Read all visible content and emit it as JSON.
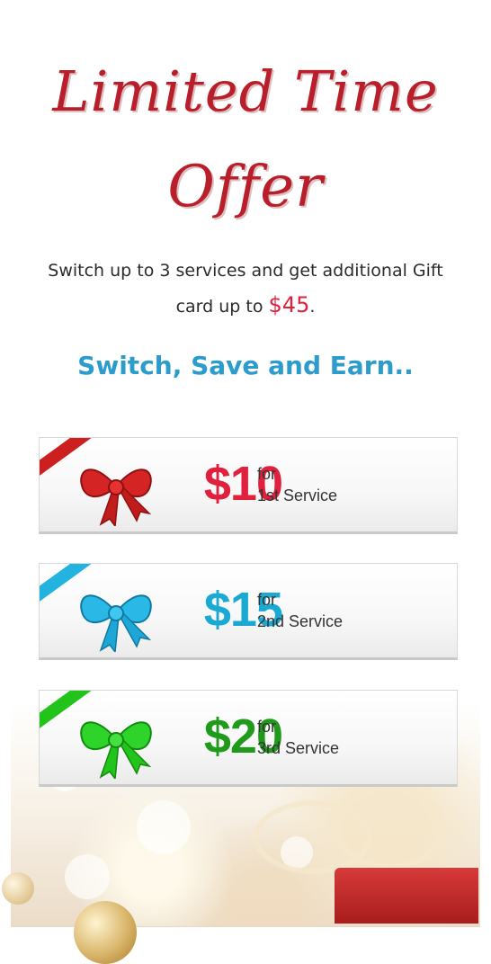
{
  "headline": {
    "line1": "Limited Time",
    "line2": "Offer"
  },
  "intro": {
    "text": "Switch up to 3 services and get additional Gift card up to",
    "amount": "$45",
    "end": "."
  },
  "tagline": "Switch, Save and Earn..",
  "offers": [
    {
      "amount": "$10",
      "for": "for",
      "service": "1st Service",
      "color": "#e0203c",
      "ribbon_color": "#cc1f1f"
    },
    {
      "amount": "$15",
      "for": "for",
      "service": "2nd Service",
      "color": "#19a9d3",
      "ribbon_color": "#23b3df"
    },
    {
      "amount": "$20",
      "for": "for",
      "service": "3rd Service",
      "color": "#1f9a1a",
      "ribbon_color": "#22c41c"
    }
  ]
}
